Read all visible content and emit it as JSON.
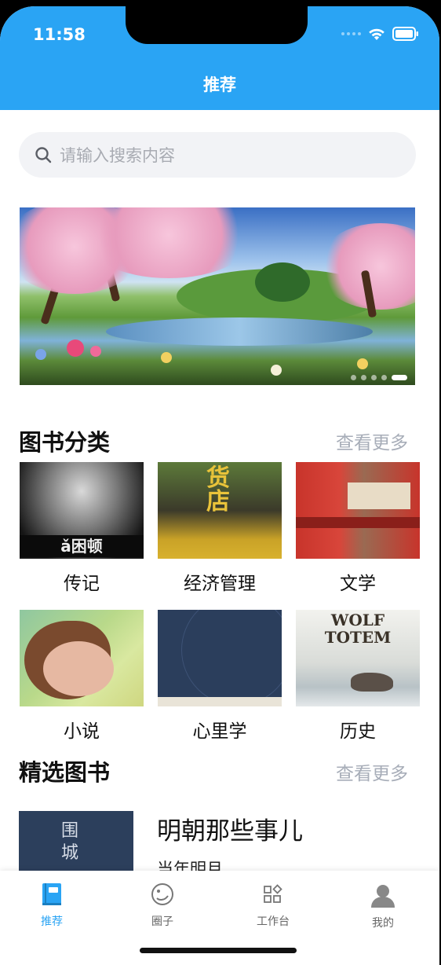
{
  "status": {
    "time": "11:58"
  },
  "header": {
    "title": "推荐"
  },
  "search": {
    "placeholder": "请输入搜索内容",
    "icon": "search-icon"
  },
  "banner": {
    "slides": 5,
    "active_index": 4
  },
  "categories_section": {
    "title": "图书分类",
    "more": "查看更多",
    "items": [
      {
        "label": "传记",
        "cover_text": "ǎ困顿"
      },
      {
        "label": "经济管理",
        "cover_text": "货店"
      },
      {
        "label": "文学"
      },
      {
        "label": "小说"
      },
      {
        "label": "心里学"
      },
      {
        "label": "历史",
        "cover_text": "WOLF TOTEM"
      }
    ]
  },
  "featured_section": {
    "title": "精选图书",
    "more": "查看更多",
    "book": {
      "title": "明朝那些事儿",
      "author": "当年明月",
      "cover_text": "围城"
    }
  },
  "tabbar": {
    "items": [
      {
        "label": "推荐",
        "icon": "book-icon",
        "active": true
      },
      {
        "label": "圈子",
        "icon": "planet-icon",
        "active": false
      },
      {
        "label": "工作台",
        "icon": "grid-icon",
        "active": false
      },
      {
        "label": "我的",
        "icon": "user-icon",
        "active": false
      }
    ]
  },
  "colors": {
    "primary": "#2aa4f4",
    "muted": "#a7adb8"
  }
}
